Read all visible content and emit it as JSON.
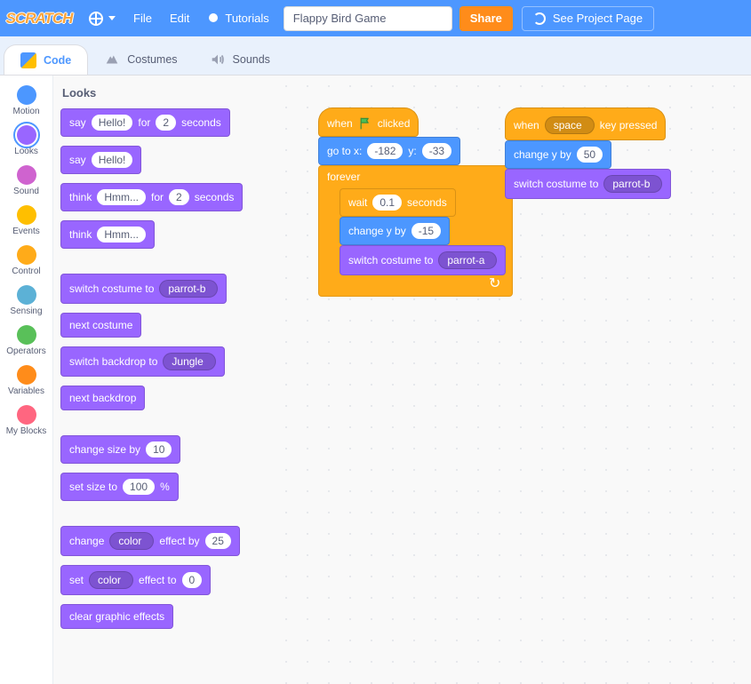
{
  "menubar": {
    "file": "File",
    "edit": "Edit",
    "tutorials": "Tutorials",
    "project_title": "Flappy Bird Game",
    "share": "Share",
    "see_project": "See Project Page"
  },
  "tabs": {
    "code": "Code",
    "costumes": "Costumes",
    "sounds": "Sounds"
  },
  "categories": [
    {
      "id": "motion",
      "label": "Motion",
      "color": "#4c97ff"
    },
    {
      "id": "looks",
      "label": "Looks",
      "color": "#9966ff"
    },
    {
      "id": "sound",
      "label": "Sound",
      "color": "#cf63cf"
    },
    {
      "id": "events",
      "label": "Events",
      "color": "#ffbf00"
    },
    {
      "id": "control",
      "label": "Control",
      "color": "#ffab19"
    },
    {
      "id": "sensing",
      "label": "Sensing",
      "color": "#5cb1d6"
    },
    {
      "id": "operators",
      "label": "Operators",
      "color": "#59c059"
    },
    {
      "id": "variables",
      "label": "Variables",
      "color": "#ff8c1a"
    },
    {
      "id": "myblocks",
      "label": "My Blocks",
      "color": "#ff6680"
    }
  ],
  "selected_category": "looks",
  "palette_title": "Looks",
  "palette": {
    "say_for": {
      "op": "say",
      "text": "Hello!",
      "for": "for",
      "secs": "2",
      "unit": "seconds"
    },
    "say": {
      "op": "say",
      "text": "Hello!"
    },
    "think_for": {
      "op": "think",
      "text": "Hmm...",
      "for": "for",
      "secs": "2",
      "unit": "seconds"
    },
    "think": {
      "op": "think",
      "text": "Hmm..."
    },
    "switch_costume": {
      "op": "switch costume to",
      "val": "parrot-b"
    },
    "next_costume": "next costume",
    "switch_backdrop": {
      "op": "switch backdrop to",
      "val": "Jungle"
    },
    "next_backdrop": "next backdrop",
    "change_size": {
      "op": "change size by",
      "val": "10"
    },
    "set_size": {
      "op": "set size to",
      "val": "100",
      "pct": "%"
    },
    "change_effect": {
      "op1": "change",
      "effect": "color",
      "op2": "effect by",
      "val": "25"
    },
    "set_effect": {
      "op1": "set",
      "effect": "color",
      "op2": "effect to",
      "val": "0"
    },
    "clear_effects": "clear graphic effects"
  },
  "workspace": {
    "script1": {
      "when_flag": {
        "when": "when",
        "clicked": "clicked"
      },
      "go_to": {
        "op": "go to x:",
        "x": "-182",
        "ylabel": "y:",
        "y": "-33"
      },
      "forever": "forever",
      "wait": {
        "op": "wait",
        "val": "0.1",
        "unit": "seconds"
      },
      "change_y": {
        "op": "change y by",
        "val": "-15"
      },
      "switch_costume": {
        "op": "switch costume to",
        "val": "parrot-a"
      }
    },
    "script2": {
      "when_key": {
        "when": "when",
        "key": "space",
        "pressed": "key pressed"
      },
      "change_y": {
        "op": "change y by",
        "val": "50"
      },
      "switch_costume": {
        "op": "switch costume to",
        "val": "parrot-b"
      }
    }
  }
}
